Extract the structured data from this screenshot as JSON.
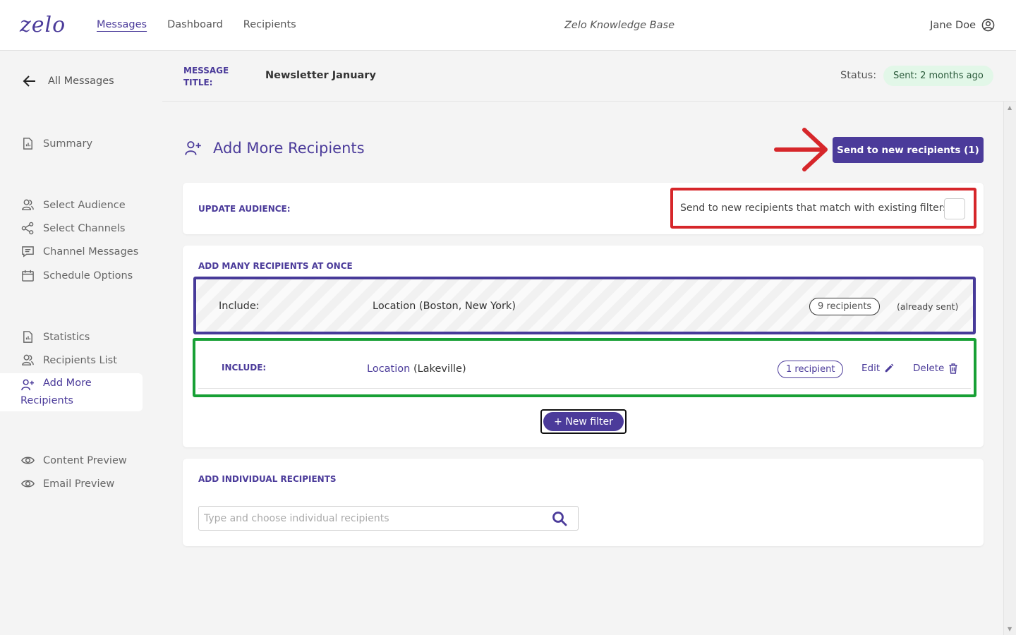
{
  "header": {
    "logo": "zelo",
    "nav": [
      "Messages",
      "Dashboard",
      "Recipients"
    ],
    "knowledge_base": "Zelo Knowledge Base",
    "user_name": "Jane Doe"
  },
  "sidebar": {
    "back_label": "All Messages",
    "items": [
      {
        "label": "Summary",
        "icon": "report-icon"
      },
      {
        "label": "Select Audience",
        "icon": "people-icon"
      },
      {
        "label": "Select Channels",
        "icon": "share-icon"
      },
      {
        "label": "Channel Messages",
        "icon": "chat-icon"
      },
      {
        "label": "Schedule Options",
        "icon": "calendar-icon"
      },
      {
        "label": "Statistics",
        "icon": "report-icon"
      },
      {
        "label": "Recipients List",
        "icon": "people-icon"
      },
      {
        "label": "Content Preview",
        "icon": "eye-icon"
      },
      {
        "label": "Email Preview",
        "icon": "eye-icon"
      }
    ],
    "active": {
      "label_line1": "Add More",
      "label_line2": "Recipients",
      "icon": "add-person-icon"
    }
  },
  "message": {
    "title_label": "MESSAGE TITLE:",
    "title_value": "Newsletter January",
    "status_label": "Status:",
    "status_value": "Sent: 2 months ago"
  },
  "main": {
    "title": "Add More Recipients",
    "send_button": "Send to new recipients (1)",
    "update_audience": {
      "label": "UPDATE AUDIENCE:",
      "checkbox_text": "Send to new recipients that match with existing filters",
      "checked": false
    },
    "bulk": {
      "label": "ADD MANY RECIPIENTS AT ONCE",
      "existing_filter": {
        "include": "Include:",
        "location": "Location (Boston, New York)",
        "count": "9 recipients",
        "note": "(already sent)"
      },
      "new_filter": {
        "include": "INCLUDE:",
        "location_field": "Location",
        "location_value": "(Lakeville)",
        "count": "1 recipient",
        "edit": "Edit",
        "delete": "Delete"
      },
      "new_filter_button": "+ New filter"
    },
    "individual": {
      "label": "ADD INDIVIDUAL RECIPIENTS",
      "placeholder": "Type and choose individual recipients"
    }
  },
  "colors": {
    "brand": "#4b3b9a",
    "status_bg": "#e2f7e8",
    "annotation_red": "#d6262a",
    "annotation_purple": "#473a99",
    "annotation_green": "#17a035"
  }
}
